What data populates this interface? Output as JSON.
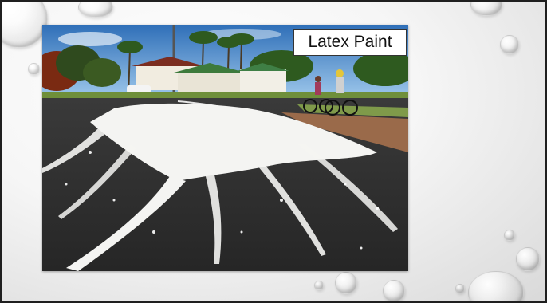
{
  "slide": {
    "title": "Latex Paint"
  },
  "photo": {
    "icon": "street-paint-spill-photo"
  }
}
